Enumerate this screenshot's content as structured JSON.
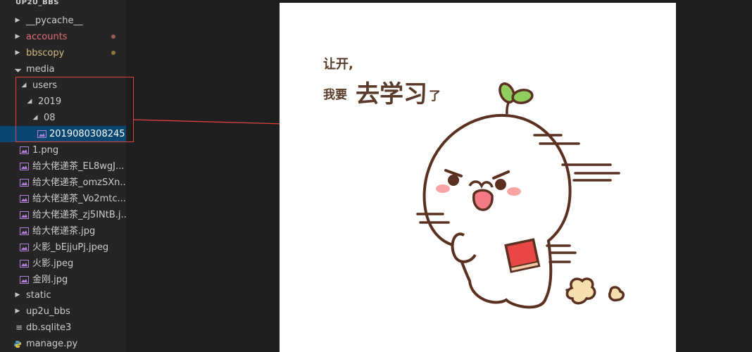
{
  "explorer": {
    "root_label": "UP2U_BBS",
    "items": [
      {
        "label": "__pycache__",
        "type": "folder",
        "expanded": false
      },
      {
        "label": "accounts",
        "type": "folder",
        "expanded": false,
        "status_color": "#e06c75"
      },
      {
        "label": "bbscopy",
        "type": "folder",
        "expanded": false,
        "status_color": "#d7ba7d"
      },
      {
        "label": "media",
        "type": "folder",
        "expanded": true
      },
      {
        "label": "users",
        "type": "folder",
        "expanded": true
      },
      {
        "label": "2019",
        "type": "folder",
        "expanded": true
      },
      {
        "label": "08",
        "type": "folder",
        "expanded": true
      },
      {
        "label": "2019080308245...",
        "type": "image",
        "selected": true
      },
      {
        "label": "1.png",
        "type": "image"
      },
      {
        "label": "给大佬递茶_EL8wgJ...",
        "type": "image"
      },
      {
        "label": "给大佬递茶_omzSXn...",
        "type": "image"
      },
      {
        "label": "给大佬递茶_Vo2mtc...",
        "type": "image"
      },
      {
        "label": "给大佬递茶_zj5INtB.j...",
        "type": "image"
      },
      {
        "label": "给大佬递茶.jpg",
        "type": "image"
      },
      {
        "label": "火影_bEjjuPj.jpeg",
        "type": "image"
      },
      {
        "label": "火影.jpeg",
        "type": "image"
      },
      {
        "label": "金刚.jpg",
        "type": "image"
      },
      {
        "label": "static",
        "type": "folder",
        "expanded": false
      },
      {
        "label": "up2u_bbs",
        "type": "folder",
        "expanded": false
      },
      {
        "label": "db.sqlite3",
        "type": "database"
      },
      {
        "label": "manage.py",
        "type": "python"
      }
    ]
  },
  "preview": {
    "caption_line1": "让开,",
    "caption_line2_prefix": "我要",
    "caption_line2_big": "去学习",
    "caption_line2_suffix": "了"
  },
  "colors": {
    "selection": "#094771",
    "annotation_red": "#e04040",
    "image_icon": "#b180d7"
  }
}
